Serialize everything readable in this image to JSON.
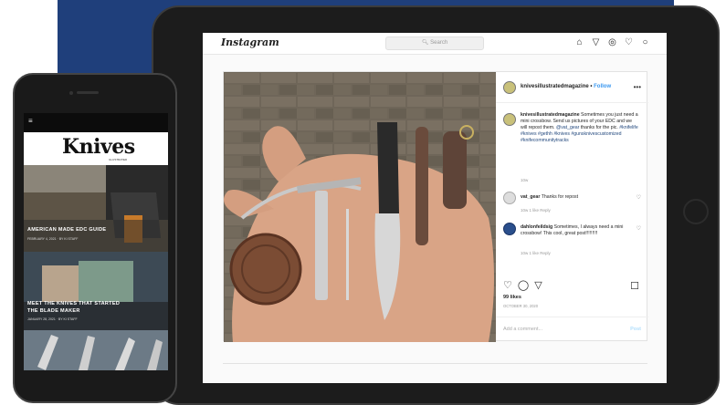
{
  "instagram": {
    "logo": "Instagram",
    "search_placeholder": "Search",
    "nav_icons": [
      "home-icon",
      "direct-icon",
      "explore-icon",
      "heart-icon",
      "profile-icon"
    ],
    "post": {
      "account": "knivesillustratedmagazine",
      "follow_label": "Follow",
      "caption_account": "knivesillustratedmagazine",
      "caption_text_1": "Sometimes you just need a mini crossbow. Send us pictures of your EDC and we will repost them.",
      "caption_mention": "@vat_gear",
      "caption_text_2": "thanks for the pic.",
      "caption_tags_1": "#knifelife #knives #gethh #knives",
      "caption_tags_2": "#gunsknivescustomized",
      "caption_tags_3": "#knifecommunitytracks",
      "caption_time": "10w",
      "comments": [
        {
          "user": "vat_gear",
          "text": "Thanks for repost ",
          "meta": "10w  1 like  Reply"
        },
        {
          "user": "dahlonfeildsig",
          "text": "Sometimes, I always need a mini crossbow! This cool, great post!!!!!!!!!",
          "meta": "10w  1 like  Reply"
        }
      ],
      "likes": "99 likes",
      "date": "OCTOBER 30, 2020",
      "comment_placeholder": "Add a comment...",
      "post_label": "Post"
    }
  },
  "phone": {
    "logo": "Knives",
    "logo_sub": "ILLUSTRATED",
    "articles": [
      {
        "title": "AMERICAN MADE EDC GUIDE",
        "date": "FEBRUARY 4, 2021 · BY KI STAFF"
      },
      {
        "title": "MEET THE KNIVES THAT STARTED",
        "title_2": "THE BLADE MAKER",
        "date": "JANUARY 28, 2021 · BY KI STAFF"
      }
    ]
  },
  "colors": {
    "band": "#1f3f7b",
    "link_blue": "#3897f0"
  }
}
